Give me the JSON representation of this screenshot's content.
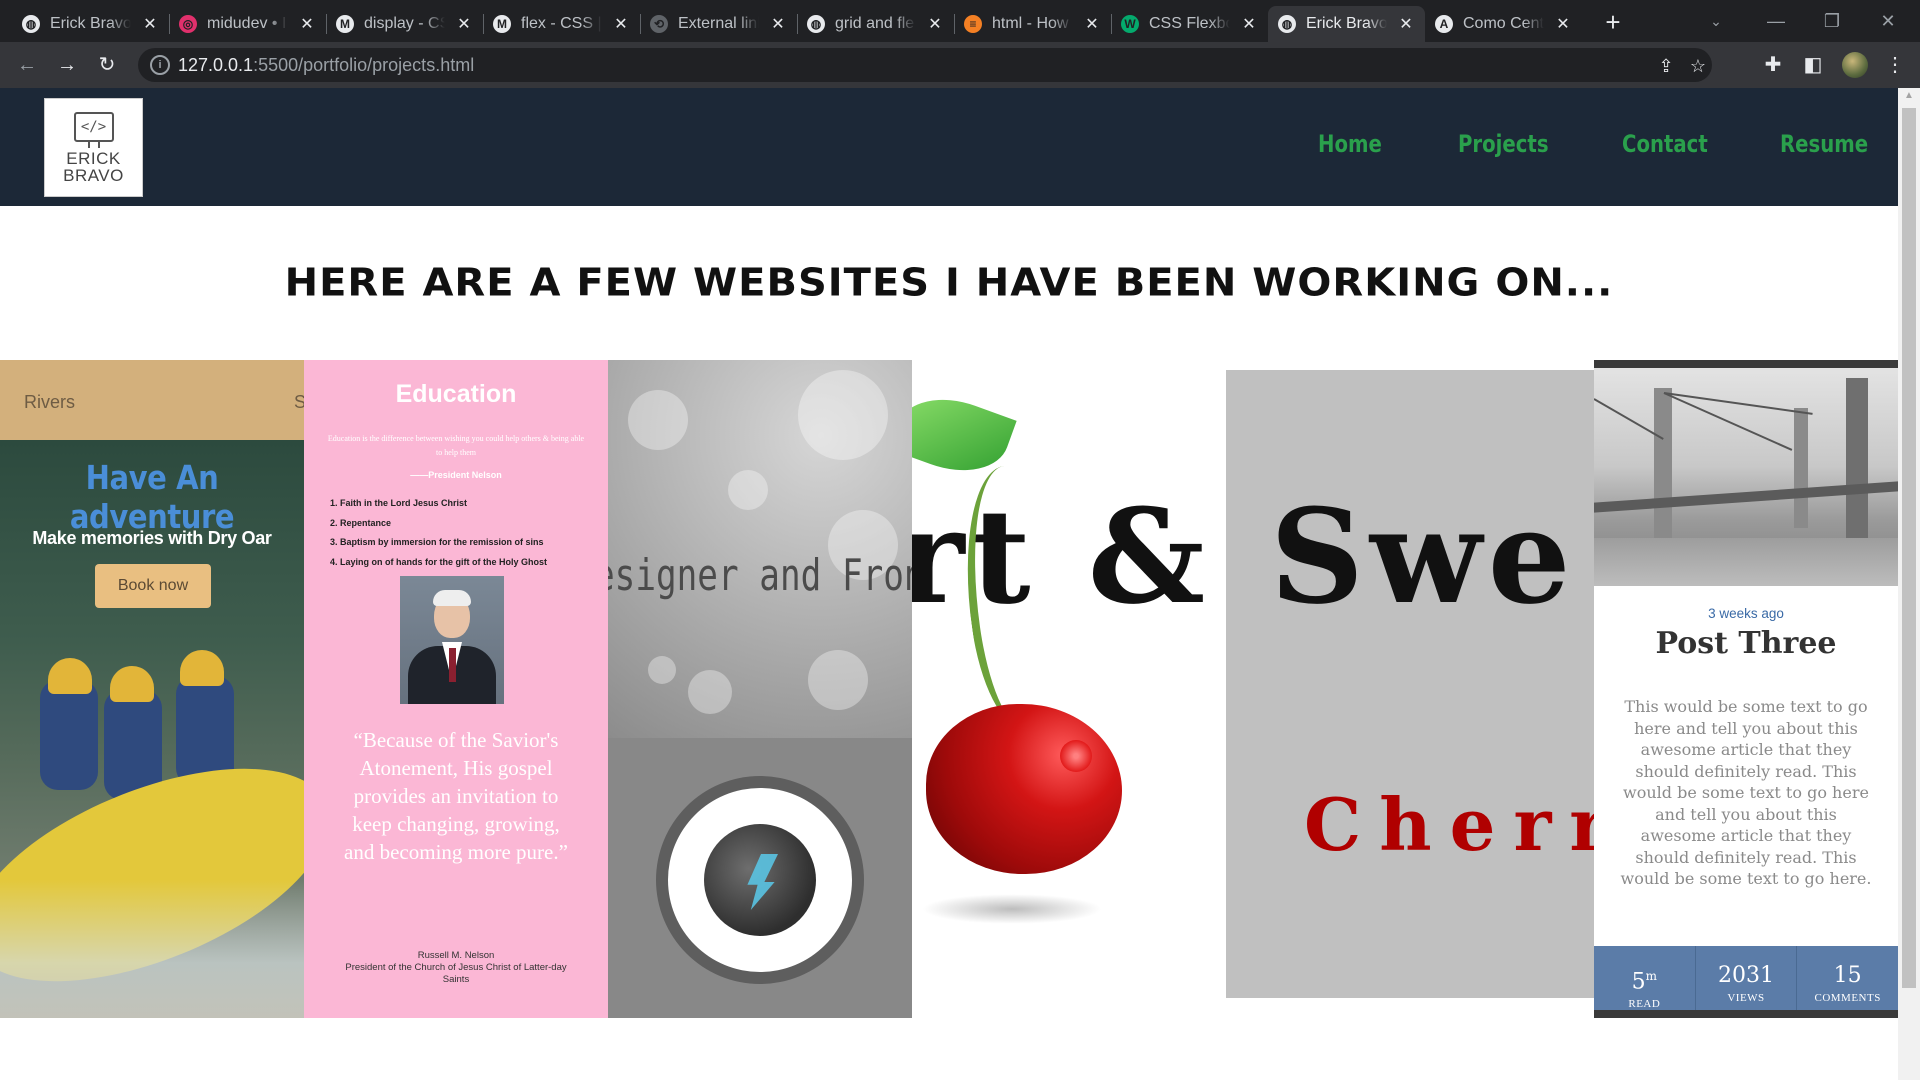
{
  "browser": {
    "tabs": [
      {
        "title": "Erick Bravo",
        "favicon": "globe-icon",
        "color": "#e8eaed",
        "active": false
      },
      {
        "title": "midudev • I",
        "favicon": "instagram-icon",
        "color": "#e1306c",
        "active": false
      },
      {
        "title": "display - CS",
        "favicon": "mdn-icon",
        "color": "#e8eaed",
        "active": false
      },
      {
        "title": "flex - CSS | I",
        "favicon": "mdn-icon",
        "color": "#e8eaed",
        "active": false
      },
      {
        "title": "External link",
        "favicon": "link-icon",
        "color": "#5f6368",
        "active": false
      },
      {
        "title": "grid and fle",
        "favicon": "globe-icon",
        "color": "#e8eaed",
        "active": false
      },
      {
        "title": "html - How",
        "favicon": "stackoverflow-icon",
        "color": "#f48024",
        "active": false
      },
      {
        "title": "CSS Flexbox",
        "favicon": "w3schools-icon",
        "color": "#04aa6d",
        "active": false
      },
      {
        "title": "Erick Bravo",
        "favicon": "globe-icon",
        "color": "#e8eaed",
        "active": true
      },
      {
        "title": "Como Cent",
        "favicon": "astro-icon",
        "color": "#e8eaed",
        "active": false
      }
    ],
    "url_host": "127.0.0.1",
    "url_rest": ":5500/portfolio/projects.html"
  },
  "site": {
    "logo_line1": "ERICK",
    "logo_line2": "BRAVO",
    "logo_code": "</>",
    "nav": [
      "Home",
      "Projects",
      "Contact",
      "Resume"
    ],
    "headline": "Here are a few websites I have been working on..."
  },
  "cards": {
    "rivers": {
      "brand": "Rivers",
      "brand_cut": "S",
      "headline": "Have An adventure",
      "subline": "Make memories with Dry Oar",
      "button": "Book now"
    },
    "education": {
      "title": "Education",
      "quote": "Education is the difference between wishing you could help others & being able to help them",
      "author": "——President Nelson",
      "list": [
        "1. Faith in the Lord Jesus Christ",
        "2. Repentance",
        "3. Baptism by immersion for the remission of sins",
        "4. Laying on of hands for the gift of the Holy Ghost"
      ],
      "big_quote": "“Because of the Savior's Atonement, His gospel provides an invitation to keep changing, growing, and becoming more pure.”",
      "signature_name": "Russell M. Nelson",
      "signature_role": "President of the Church of Jesus Christ of Latter-day Saints"
    },
    "designer": {
      "role_text": "esigner and Front"
    },
    "cherry": {
      "title_fragment": "rt &"
    },
    "sweet": {
      "word_fragment": "Swe",
      "cherry_fragment": "Cherr"
    },
    "post": {
      "ago": "3 weeks ago",
      "title": "Post Three",
      "excerpt": "This would be some text to go here and tell you about this awesome article that they should definitely read. This would be some text to go here and tell you about this awesome article that they should definitely read. This would be some text to go here.",
      "stats": [
        {
          "num": "5",
          "sup": "m",
          "label": "READ"
        },
        {
          "num": "2031",
          "sup": "",
          "label": "VIEWS"
        },
        {
          "num": "15",
          "sup": "",
          "label": "COMMENTS"
        }
      ]
    }
  }
}
